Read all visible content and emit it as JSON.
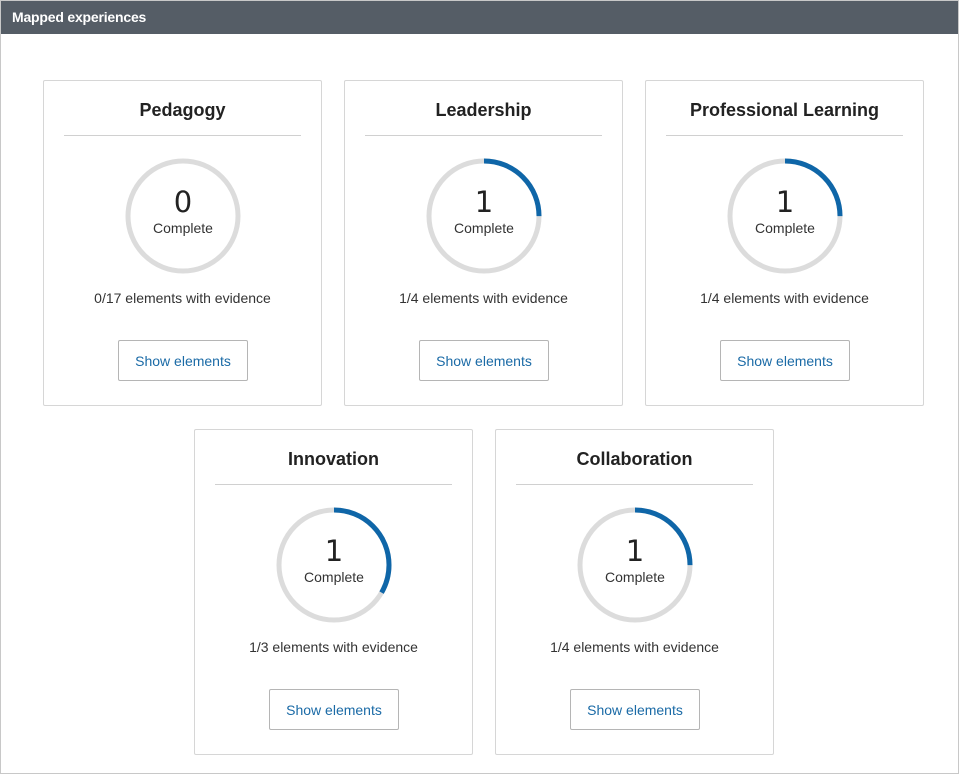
{
  "header": {
    "title": "Mapped experiences"
  },
  "colors": {
    "ring_track": "#dcdcdc",
    "ring_progress": "#0f66a8",
    "header_bg": "#555d66",
    "link": "#1a6aa6"
  },
  "cards": [
    {
      "title": "Pedagogy",
      "complete_count": "0",
      "complete_label": "Complete",
      "completed": 0,
      "total": 17,
      "evidence_text": "0/17 elements with evidence",
      "button_label": "Show elements"
    },
    {
      "title": "Leadership",
      "complete_count": "1",
      "complete_label": "Complete",
      "completed": 1,
      "total": 4,
      "evidence_text": "1/4 elements with evidence",
      "button_label": "Show elements"
    },
    {
      "title": "Professional Learning",
      "complete_count": "1",
      "complete_label": "Complete",
      "completed": 1,
      "total": 4,
      "evidence_text": "1/4 elements with evidence",
      "button_label": "Show elements"
    },
    {
      "title": "Innovation",
      "complete_count": "1",
      "complete_label": "Complete",
      "completed": 1,
      "total": 3,
      "evidence_text": "1/3 elements with evidence",
      "button_label": "Show elements"
    },
    {
      "title": "Collaboration",
      "complete_count": "1",
      "complete_label": "Complete",
      "completed": 1,
      "total": 4,
      "evidence_text": "1/4 elements with evidence",
      "button_label": "Show elements"
    }
  ]
}
